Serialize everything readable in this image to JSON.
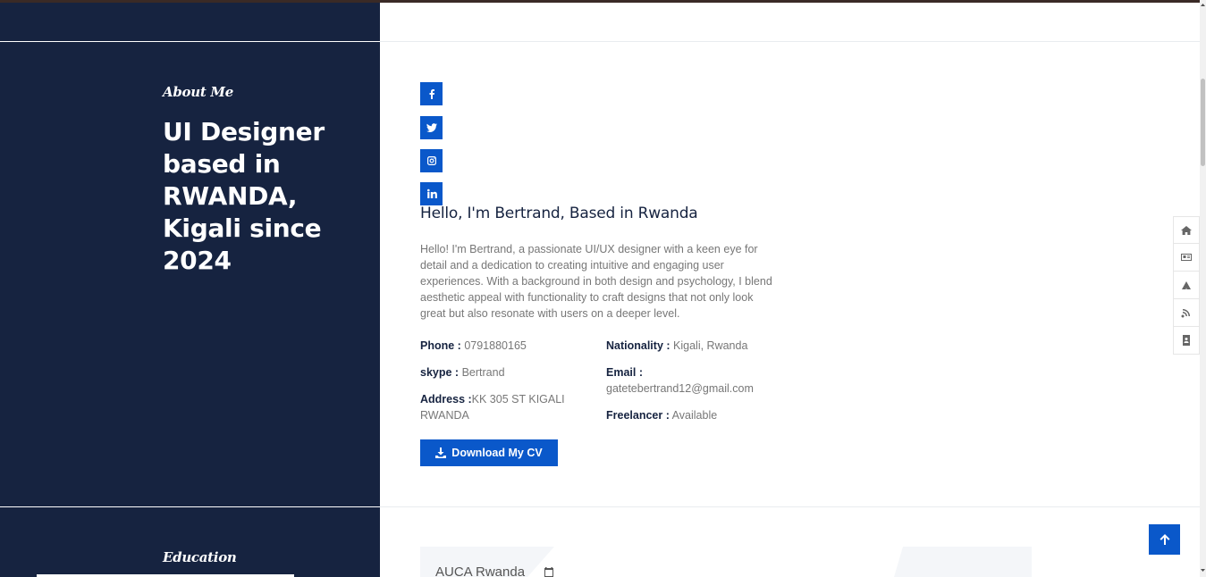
{
  "about": {
    "kicker": "About Me",
    "title": "UI Designer based in RWANDA, Kigali since 2024"
  },
  "education": {
    "kicker": "Education",
    "card_title": "AUCA Rwanda"
  },
  "social": [
    {
      "icon": "facebook-icon"
    },
    {
      "icon": "twitter-icon"
    },
    {
      "icon": "instagram-icon"
    },
    {
      "icon": "linkedin-icon"
    }
  ],
  "profile": {
    "heading": "Hello, I'm Bertrand, Based in Rwanda",
    "bio": "Hello! I'm Bertrand, a passionate UI/UX designer with a keen eye for detail and a dedication to creating intuitive and engaging user experiences. With a background in both design and psychology, I blend aesthetic appeal with functionality to craft designs that not only look great but also resonate with users on a deeper level.",
    "phone_label": "Phone :",
    "phone_value": "0791880165",
    "skype_label": "skype :",
    "skype_value": "Bertrand",
    "address_label": "Address :",
    "address_value": "KK 305 ST KIGALI RWANDA",
    "nationality_label": "Nationality :",
    "nationality_value": "Kigali, Rwanda",
    "email_label": "Email :",
    "email_value": "gatetebertrand12@gmail.com",
    "freelancer_label": "Freelancer :",
    "freelancer_value": "Available"
  },
  "download_button": "Download My CV",
  "side_nav": [
    "home-icon",
    "id-card-icon",
    "paper-plane-icon",
    "blog-icon",
    "contact-book-icon"
  ],
  "colors": {
    "sidebar_bg": "#162340",
    "accent": "#0a58ca",
    "heading_text": "#162340",
    "body_text": "#777777"
  }
}
